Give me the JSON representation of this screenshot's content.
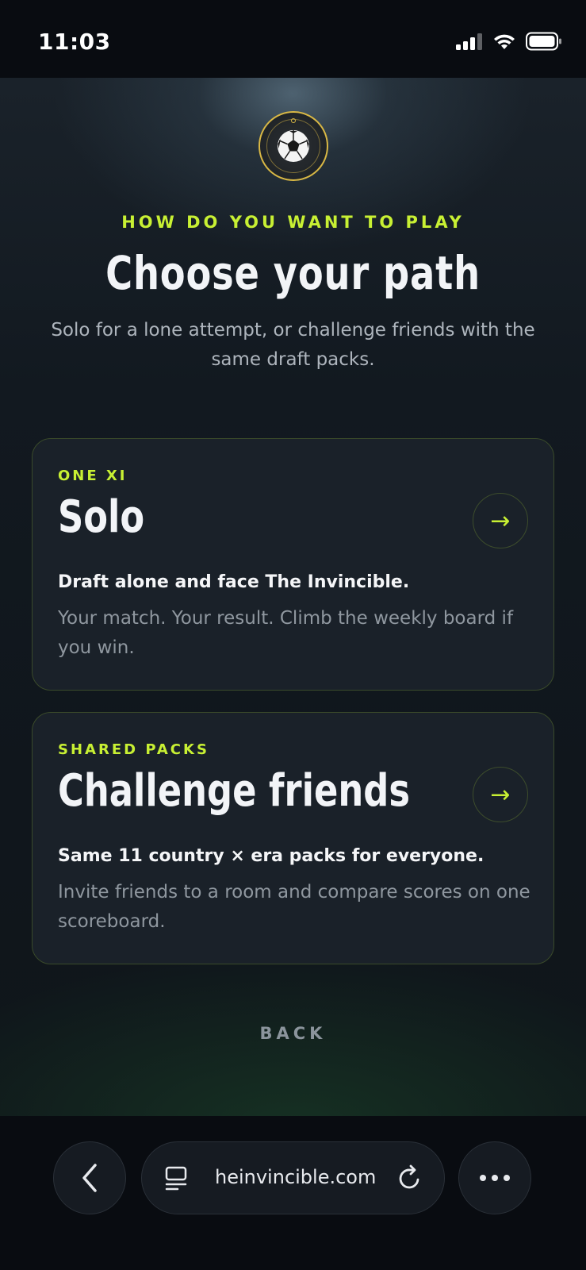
{
  "status_bar": {
    "time": "11:03"
  },
  "header": {
    "eyebrow": "HOW DO YOU WANT TO PLAY",
    "title": "Choose your path",
    "subtitle": "Solo for a lone attempt, or challenge friends with the same draft packs."
  },
  "cards": [
    {
      "eyebrow": "ONE XI",
      "title": "Solo",
      "lead": "Draft alone and face The Invincible.",
      "description": "Your match. Your result. Climb the weekly board if you win.",
      "arrow": "→"
    },
    {
      "eyebrow": "SHARED PACKS",
      "title": "Challenge friends",
      "lead": "Same 11 country × era packs for everyone.",
      "description": "Invite friends to a room and compare scores on one scoreboard.",
      "arrow": "→"
    }
  ],
  "back_label": "BACK",
  "browser": {
    "url": "heinvincible.com"
  },
  "colors": {
    "accent": "#c8f033",
    "gold": "#d9b845",
    "card_bg": "#1a2129",
    "card_border": "#3a4a2a"
  },
  "icons": [
    "signal-icon",
    "wifi-icon",
    "battery-icon",
    "football-logo-icon",
    "arrow-right-icon",
    "chevron-left-icon",
    "tabs-icon",
    "reload-icon",
    "more-icon"
  ]
}
